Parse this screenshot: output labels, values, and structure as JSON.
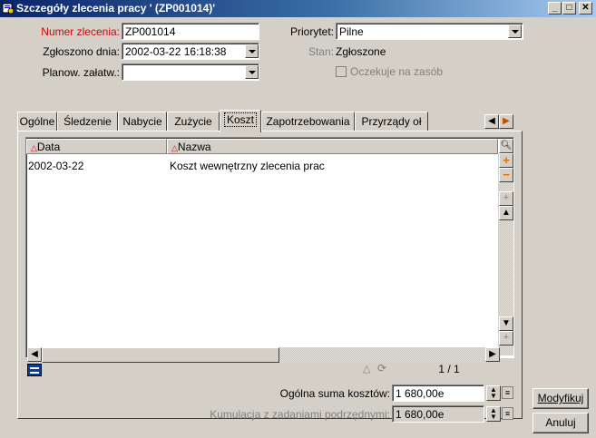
{
  "window": {
    "title": "Szczegóły zlecenia pracy ' (ZP001014)'",
    "title_color": "#0a246a",
    "app_icon": "work-order-icon",
    "controls": [
      "minimize-icon",
      "maximize-icon",
      "close-icon"
    ]
  },
  "form": {
    "order_number_label": "Numer zlecenia:",
    "order_number_value": "ZP001014",
    "reported_label": "Zgłoszono dnia:",
    "reported_value": "2002-03-22 16:18:38",
    "planned_label": "Planow. załatw.:",
    "planned_value": "",
    "priority_label": "Priorytet:",
    "priority_value": "Pilne",
    "status_label": "Stan:",
    "status_value": "Zgłoszone",
    "awaiting_label": "Oczekuje na zasób",
    "awaiting_checked": false,
    "required_color": "#d40000"
  },
  "tabs": [
    {
      "label": "Ogólne"
    },
    {
      "label": "Śledzenie"
    },
    {
      "label": "Nabycie"
    },
    {
      "label": "Zużycie"
    },
    {
      "label": "Koszt",
      "active": true
    },
    {
      "label": "Zapotrzebowania"
    },
    {
      "label": "Przyrządy oł"
    }
  ],
  "table": {
    "columns": [
      "Data",
      "Nazwa"
    ],
    "rows": [
      {
        "data": "2002-03-22",
        "nazwa": "Koszt wewnętrzny zlecenia prac"
      }
    ],
    "pager": "1 / 1"
  },
  "totals": {
    "total_label": "Ogólna suma kosztów:",
    "total_value": "1 680,00e",
    "cumulative_label": "Kumulacja z zadaniami podrzędnymi:",
    "cumulative_value": "1 680,00e"
  },
  "buttons": {
    "modify": "Modyfikuj",
    "cancel": "Anuluj"
  }
}
